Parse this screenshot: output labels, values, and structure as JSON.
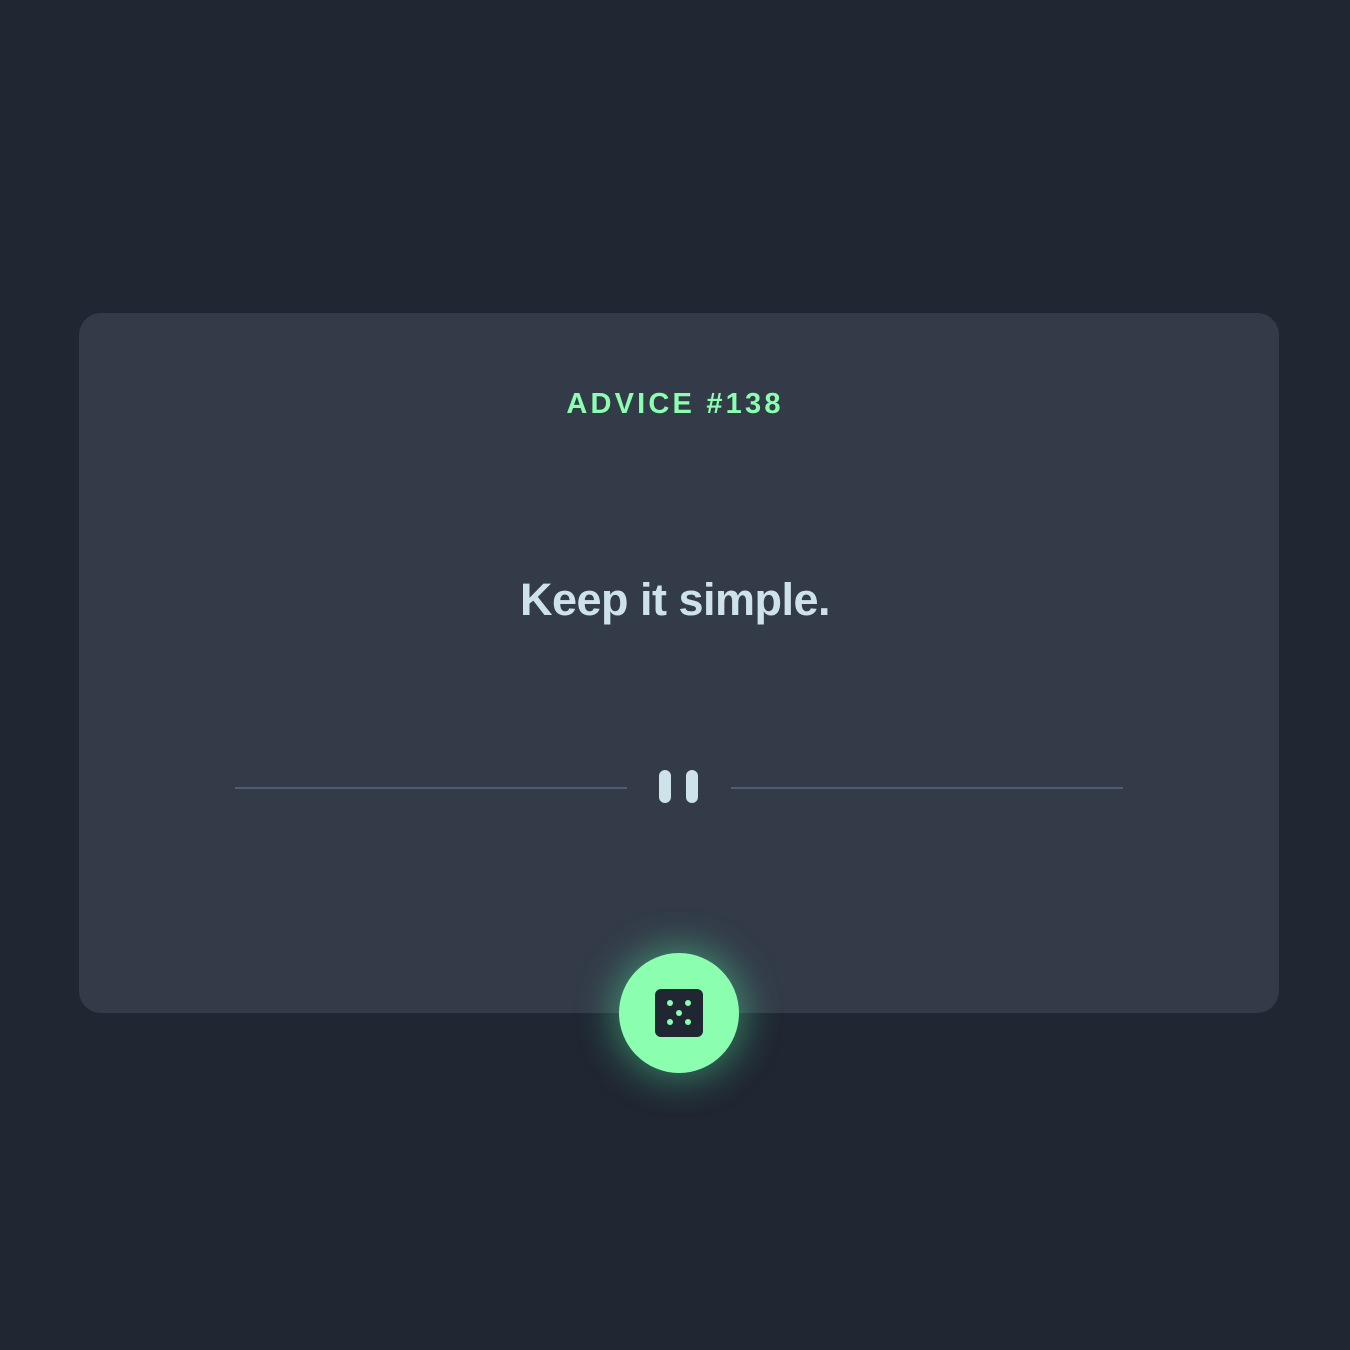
{
  "card": {
    "advice_label": "ADVICE #138",
    "advice_text": "Keep it simple."
  },
  "icons": {
    "divider": "pause-icon",
    "button": "dice-icon"
  },
  "colors": {
    "background": "#202632",
    "card": "#333a48",
    "accent": "#8cfeb0",
    "text": "#cee3e9",
    "divider": "#4f5d74"
  }
}
